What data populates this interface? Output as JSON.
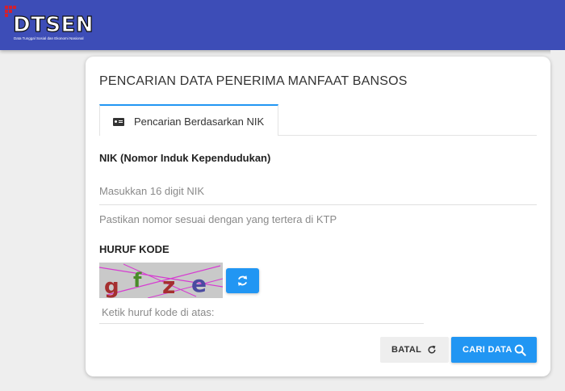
{
  "header": {
    "logo_text": "DTSEN",
    "logo_subtitle": "Data Tunggal Sosial dan Ekonomi Nasional",
    "logo_icon": "grid-dots-icon",
    "bg_color": "#3d4db7",
    "accent_color": "#d2202f"
  },
  "card": {
    "title": "PENCARIAN DATA PENERIMA MANFAAT BANSOS"
  },
  "tabs": [
    {
      "label": "Pencarian Berdasarkan NIK",
      "icon": "id-card-icon",
      "active": true
    }
  ],
  "form": {
    "nik_label": "NIK (Nomor Induk Kependudukan)",
    "nik_placeholder": "Masukkan 16 digit NIK",
    "nik_value": "",
    "nik_hint": "Pastikan nomor sesuai dengan yang tertera di KTP",
    "code_label": "HURUF KODE",
    "captcha_text": "gfze",
    "code_placeholder": "Ketik huruf kode di atas:",
    "code_value": ""
  },
  "buttons": {
    "cancel_label": "BATAL",
    "search_label": "CARI DATA",
    "primary_color": "#2196f3"
  }
}
